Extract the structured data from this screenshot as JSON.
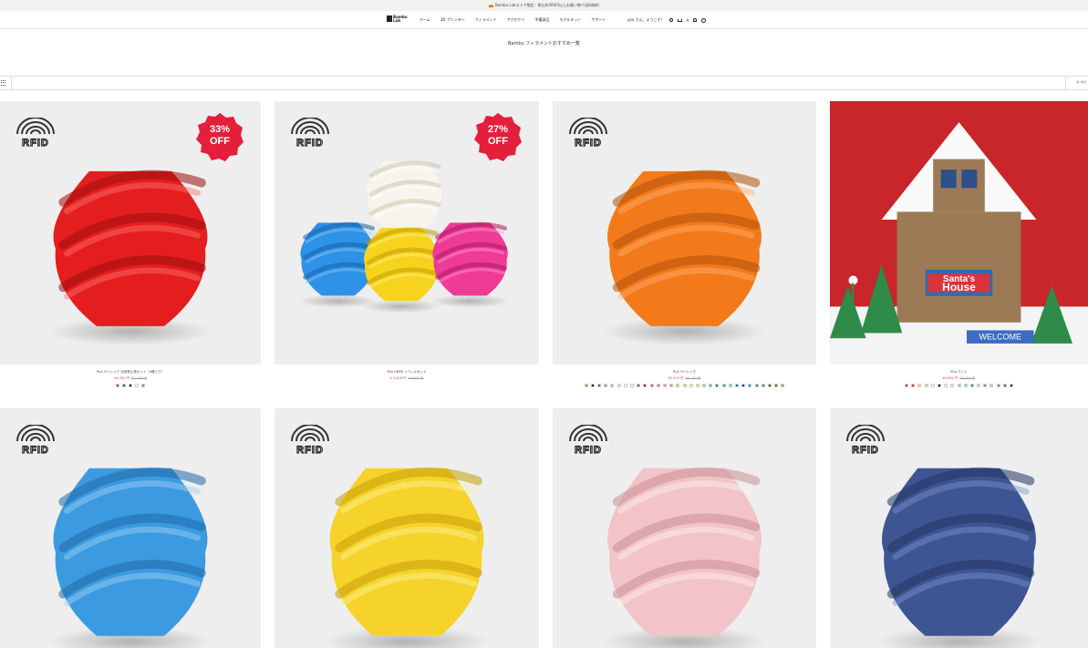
{
  "announcement": {
    "text": "Bambu Labストア限定・税込8,000円以上お買い物で送料無料"
  },
  "header": {
    "logo_text": "Bambu Lab",
    "nav": [
      "ホーム",
      "3D プリンター",
      "フィラメント",
      "アクセサリ",
      "予備部品",
      "モデルキット",
      "サポート"
    ],
    "welcome": "you さん、ようこそ！",
    "lang_short": "A"
  },
  "page_title": "Bambu フィラメントおすすめ一覧",
  "filter": {
    "sort_label": "並べ替え"
  },
  "colors": {
    "accent_red": "#e41f3b",
    "price_red": "#e04040"
  },
  "products": [
    {
      "name": "PLA ベーシック 出来栄え良セット（4巻入り）",
      "price": "¥4,782 円",
      "compare_price": "¥7,136 円",
      "badge": {
        "line1": "33%",
        "line2": "OFF"
      },
      "rfid": "RFID",
      "swatches": [
        "#e03030",
        "#2050b0",
        "#111111",
        "#ffffff",
        "#888888"
      ]
    },
    {
      "name": "PLA CMYK リフィルセット",
      "price": "¥ 3,626 円",
      "compare_price": "¥4,967 円",
      "badge": {
        "line1": "27%",
        "line2": "OFF"
      },
      "rfid": "RFID",
      "swatches": []
    },
    {
      "name": "PLA ベーシック",
      "price": "¥2,425 円",
      "compare_price": "¥3,130 円",
      "rfid": "RFID",
      "swatches": [
        "#f47a20",
        "#111111",
        "#666666",
        "#999999",
        "#bbbbbb",
        "#e0e0e0",
        "#ffffff",
        "#f0f0f0",
        "#c0392b",
        "#a01c3c",
        "#e84c6e",
        "#f06292",
        "#f48fb1",
        "#ff8a65",
        "#ffb74d",
        "#ffd54f",
        "#fff176",
        "#dce775",
        "#aed581",
        "#66bb6a",
        "#2e7d32",
        "#26a69a",
        "#4dd0e1",
        "#1565c0",
        "#283593",
        "#1e88e5",
        "#0097a7",
        "#8d6e63",
        "#5d4037",
        "#795548",
        "#9e9d24"
      ]
    },
    {
      "name": "PLA マット",
      "price": "¥2,850 円",
      "compare_price": "¥3,350 円",
      "rfid": "",
      "swatches": [
        "#e03030",
        "#c0392b",
        "#f4c97a",
        "#e8d7b0",
        "#f5f0e6",
        "#111111",
        "#ffffff",
        "#c8e0c8",
        "#9ccc9c",
        "#90caf9",
        "#1e88e5",
        "#cfd8dc",
        "#a1887f",
        "#d7ccc8",
        "#8d8d6d",
        "#556b2f",
        "#1a237e"
      ]
    },
    {
      "name": "",
      "price": "",
      "compare_price": "",
      "rfid": "RFID",
      "swatches": []
    },
    {
      "name": "",
      "price": "",
      "compare_price": "",
      "rfid": "RFID",
      "swatches": []
    },
    {
      "name": "",
      "price": "",
      "compare_price": "",
      "rfid": "RFID",
      "swatches": []
    },
    {
      "name": "",
      "price": "",
      "compare_price": "",
      "rfid": "RFID",
      "swatches": []
    }
  ],
  "house_scene": {
    "sign_line1": "Santa's",
    "sign_line2": "House",
    "welcome": "WELCOME"
  }
}
